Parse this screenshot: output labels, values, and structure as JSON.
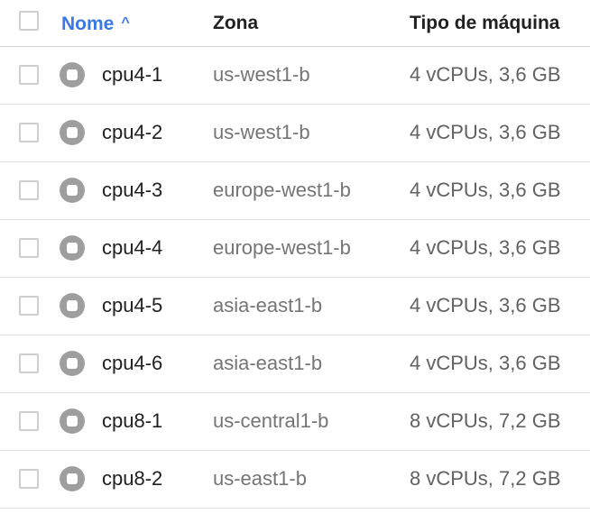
{
  "header": {
    "name_label": "Nome",
    "zone_label": "Zona",
    "type_label": "Tipo de máquina",
    "sort_glyph": "^"
  },
  "rows": [
    {
      "name": "cpu4-1",
      "zone": "us-west1-b",
      "type": "4 vCPUs, 3,6 GB"
    },
    {
      "name": "cpu4-2",
      "zone": "us-west1-b",
      "type": "4 vCPUs, 3,6 GB"
    },
    {
      "name": "cpu4-3",
      "zone": "europe-west1-b",
      "type": "4 vCPUs, 3,6 GB"
    },
    {
      "name": "cpu4-4",
      "zone": "europe-west1-b",
      "type": "4 vCPUs, 3,6 GB"
    },
    {
      "name": "cpu4-5",
      "zone": "asia-east1-b",
      "type": "4 vCPUs, 3,6 GB"
    },
    {
      "name": "cpu4-6",
      "zone": "asia-east1-b",
      "type": "4 vCPUs, 3,6 GB"
    },
    {
      "name": "cpu8-1",
      "zone": "us-central1-b",
      "type": "8 vCPUs, 7,2 GB"
    },
    {
      "name": "cpu8-2",
      "zone": "us-east1-b",
      "type": "8 vCPUs, 7,2 GB"
    }
  ],
  "colors": {
    "accent": "#3b78e7",
    "status_stopped": "#9e9e9e"
  },
  "icons": {
    "status": "stopped-status-icon",
    "sort": "sort-ascending-icon"
  }
}
